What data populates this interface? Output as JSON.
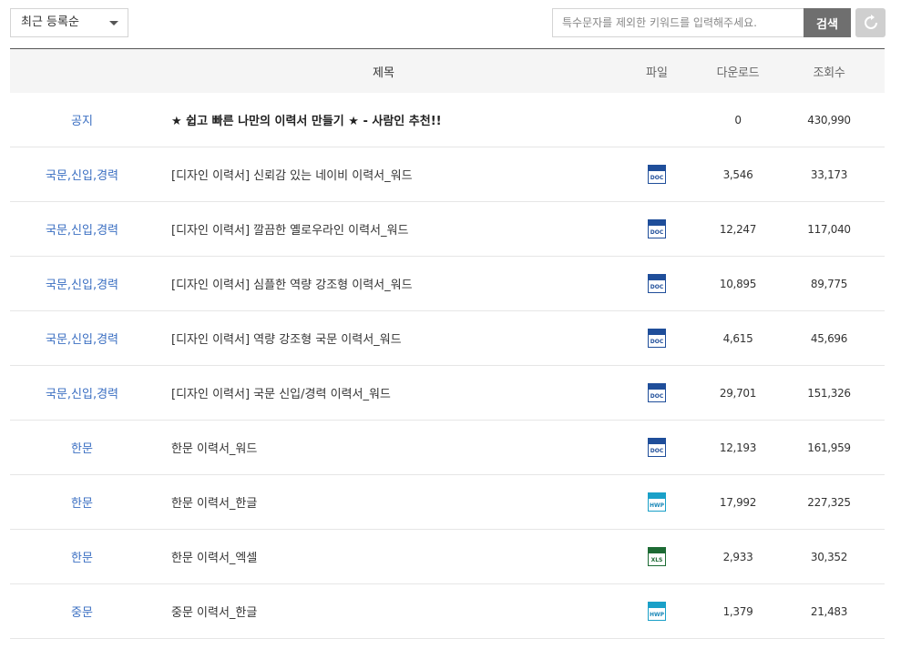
{
  "toolbar": {
    "sort_selected": "최근 등록순",
    "search_placeholder": "특수문자를 제외한 키워드를 입력해주세요.",
    "search_label": "검색"
  },
  "table": {
    "headers": {
      "title": "제목",
      "file": "파일",
      "downloads": "다운로드",
      "views": "조회수"
    },
    "rows": [
      {
        "category": "공지",
        "title": "★ 쉽고 빠른 나만의 이력서 만들기 ★ - 사람인 추천!!",
        "file": "",
        "downloads": "0",
        "views": "430,990"
      },
      {
        "category": "국문,신입,경력",
        "title": "[디자인 이력서] 신뢰감 있는 네이비 이력서_워드",
        "file": "DOC",
        "downloads": "3,546",
        "views": "33,173"
      },
      {
        "category": "국문,신입,경력",
        "title": "[디자인 이력서] 깔끔한 옐로우라인 이력서_워드",
        "file": "DOC",
        "downloads": "12,247",
        "views": "117,040"
      },
      {
        "category": "국문,신입,경력",
        "title": "[디자인 이력서] 심플한 역량 강조형 이력서_워드",
        "file": "DOC",
        "downloads": "10,895",
        "views": "89,775"
      },
      {
        "category": "국문,신입,경력",
        "title": "[디자인 이력서] 역량 강조형 국문 이력서_워드",
        "file": "DOC",
        "downloads": "4,615",
        "views": "45,696"
      },
      {
        "category": "국문,신입,경력",
        "title": "[디자인 이력서] 국문 신입/경력 이력서_워드",
        "file": "DOC",
        "downloads": "29,701",
        "views": "151,326"
      },
      {
        "category": "한문",
        "title": "한문 이력서_워드",
        "file": "DOC",
        "downloads": "12,193",
        "views": "161,959"
      },
      {
        "category": "한문",
        "title": "한문 이력서_한글",
        "file": "HWP",
        "downloads": "17,992",
        "views": "227,325"
      },
      {
        "category": "한문",
        "title": "한문 이력서_엑셀",
        "file": "XLS",
        "downloads": "2,933",
        "views": "30,352"
      },
      {
        "category": "중문",
        "title": "중문 이력서_한글",
        "file": "HWP",
        "downloads": "1,379",
        "views": "21,483"
      }
    ]
  },
  "colors": {
    "category_link": "#3b6fc2",
    "search_button_bg": "#6f6f6f",
    "reset_button_bg": "#cfcfcf",
    "doc_icon": "#1f4e9a",
    "hwp_icon": "#1aa0c8",
    "xls_icon": "#1d6b34"
  },
  "icons": {
    "sort_caret": "chevron-down-icon",
    "reset": "refresh-icon",
    "file_doc": "doc-file-icon",
    "file_hwp": "hwp-file-icon",
    "file_xls": "xls-file-icon"
  }
}
